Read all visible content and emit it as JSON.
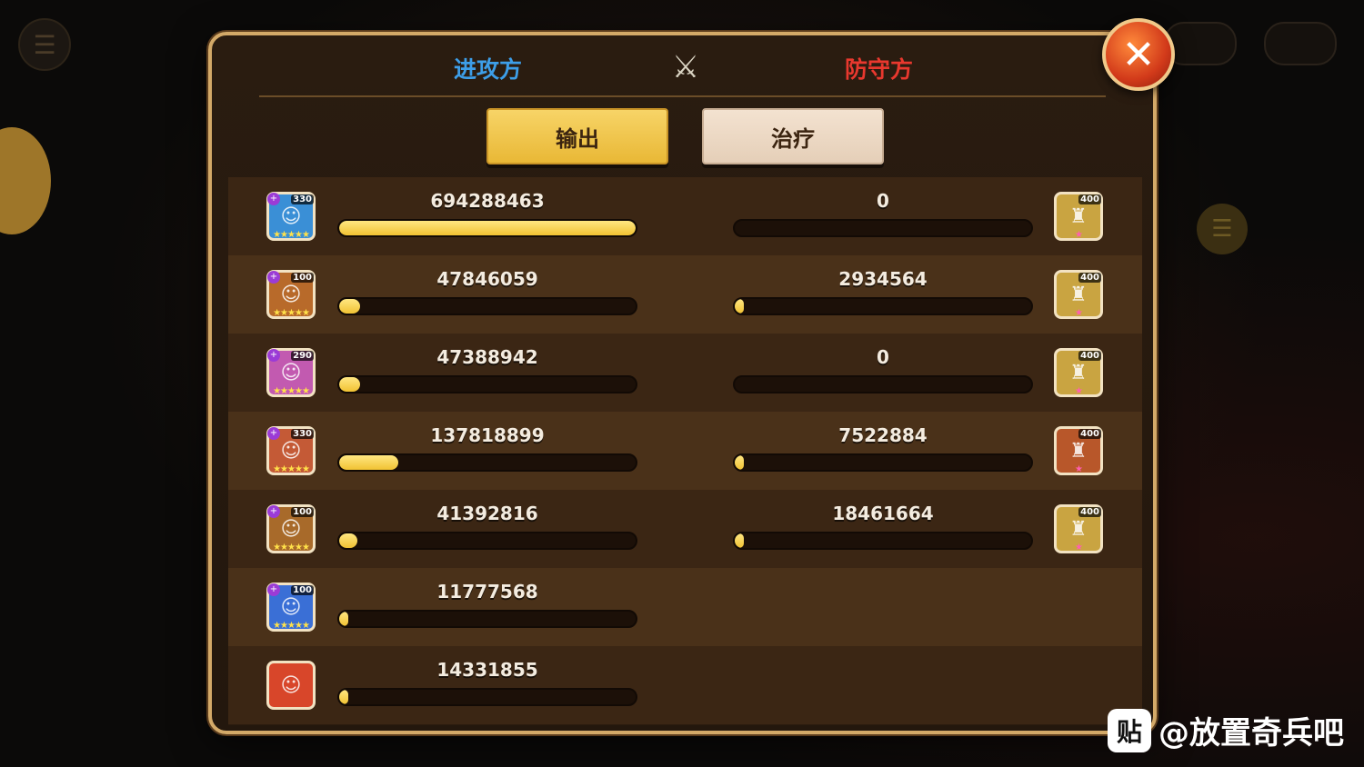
{
  "header": {
    "attack_label": "进攻方",
    "defense_label": "防守方",
    "crossed_icon": "crossed-swords-icon"
  },
  "tabs": [
    {
      "label": "输出",
      "selected": true
    },
    {
      "label": "治疗",
      "selected": false
    }
  ],
  "close_button": {
    "icon": "close-icon",
    "symbol": "✕"
  },
  "rows": [
    {
      "left": {
        "value": "694288463",
        "bar_fraction": 1.0,
        "level": "330"
      },
      "right": {
        "value": "0",
        "bar_fraction": 0.0,
        "level": "400"
      }
    },
    {
      "left": {
        "value": "47846059",
        "bar_fraction": 0.07,
        "level": "100"
      },
      "right": {
        "value": "2934564",
        "bar_fraction": 0.01,
        "level": "400"
      }
    },
    {
      "left": {
        "value": "47388942",
        "bar_fraction": 0.07,
        "level": "290"
      },
      "right": {
        "value": "0",
        "bar_fraction": 0.0,
        "level": "400"
      }
    },
    {
      "left": {
        "value": "137818899",
        "bar_fraction": 0.2,
        "level": "330"
      },
      "right": {
        "value": "7522884",
        "bar_fraction": 0.02,
        "level": "400"
      }
    },
    {
      "left": {
        "value": "41392816",
        "bar_fraction": 0.06,
        "level": "100"
      },
      "right": {
        "value": "18461664",
        "bar_fraction": 0.03,
        "level": "400"
      }
    },
    {
      "left": {
        "value": "11777568",
        "bar_fraction": 0.02,
        "level": "100"
      },
      "right": null
    },
    {
      "left": {
        "value": "14331855",
        "bar_fraction": 0.02,
        "level": ""
      },
      "right": null
    }
  ],
  "watermark": {
    "logo_text": "贴",
    "text": "@放置奇兵吧"
  },
  "colors": {
    "attack": "#3d9ee8",
    "defense": "#e8382e",
    "bar_fill": "#f1c233",
    "frame": "#d3a968"
  }
}
